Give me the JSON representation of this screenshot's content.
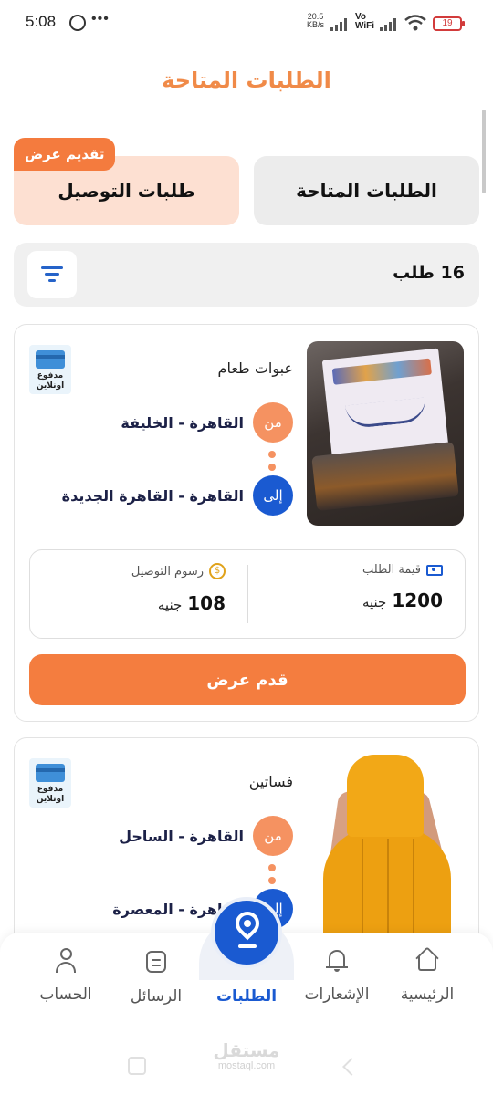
{
  "status_bar": {
    "time": "5:08",
    "dots": "•••",
    "speed_value": "20.5",
    "speed_unit": "KB/s",
    "vowifi_top": "Vo",
    "vowifi_bottom": "WiFi",
    "battery": "19",
    "battery_color": "#d23b3b"
  },
  "header": {
    "title": "الطلبات المتاحة"
  },
  "tabs": {
    "available": "الطلبات المتاحة",
    "delivery": "طلبات التوصيل",
    "offer_badge": "تقديم عرض"
  },
  "list": {
    "count_label": "16 طلب"
  },
  "orders": [
    {
      "category": "عبوات طعام",
      "payment_line1": "مدفوع",
      "payment_line2": "اونلاين",
      "from_marker": "من",
      "from": "القاهرة - الخليفة",
      "to_marker": "إلى",
      "to": "القاهرة - القاهرة الجديدة",
      "order_value_label": "قيمة الطلب",
      "order_value": "1200",
      "currency": "جنيه",
      "delivery_fee_label": "رسوم التوصيل",
      "delivery_fee": "108",
      "cta": "قدم عرض",
      "image": "food-container-photo"
    },
    {
      "category": "فساتين",
      "payment_line1": "مدفوع",
      "payment_line2": "اونلاين",
      "from_marker": "من",
      "from": "القاهرة - الساحل",
      "to_marker": "إلى",
      "to": "القاهرة - المعصرة",
      "image": "yellow-dress-photo"
    }
  ],
  "bottom_nav": [
    {
      "label": "الرئيسية",
      "icon": "home-icon"
    },
    {
      "label": "الإشعارات",
      "icon": "bell-icon"
    },
    {
      "label": "الطلبات",
      "icon": "location-pin-icon",
      "active": true
    },
    {
      "label": "الرسائل",
      "icon": "message-icon"
    },
    {
      "label": "الحساب",
      "icon": "user-icon"
    }
  ],
  "watermark": {
    "text": "مستقل",
    "sub": "mostaql.com"
  },
  "colors": {
    "accent_orange": "#f47d3f",
    "title_orange": "#f08a48",
    "primary_blue": "#1a5ad1",
    "tab_active_bg": "#fde0d2",
    "tab_inactive_bg": "#ececec"
  }
}
